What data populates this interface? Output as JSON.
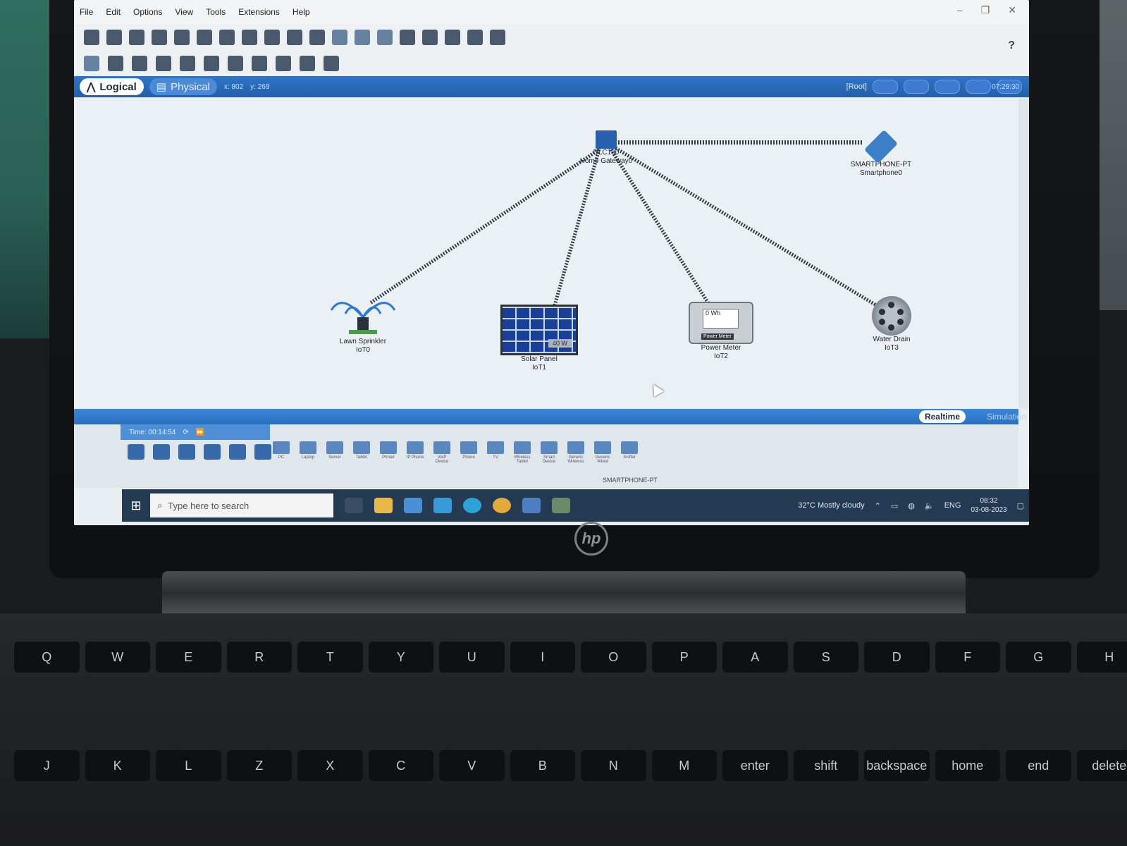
{
  "menu": [
    "File",
    "Edit",
    "Options",
    "View",
    "Tools",
    "Extensions",
    "Help"
  ],
  "help_mark": "?",
  "tabs": {
    "logical": "Logical",
    "physical": "Physical"
  },
  "coords": {
    "x": "x: 802",
    "y": "y: 269"
  },
  "root_label": "[Root]",
  "top_clock": "07:29:30",
  "devices": {
    "gateway": {
      "model": "DLC100",
      "name": "Home Gateway0"
    },
    "smartphone": {
      "model": "SMARTPHONE-PT",
      "name": "Smartphone0"
    },
    "sprinkler": {
      "model": "Lawn Sprinkler",
      "name": "IoT0"
    },
    "solar": {
      "model": "Solar Panel",
      "name": "IoT1",
      "reading": "40 W"
    },
    "meter": {
      "model": "Power Meter",
      "name": "IoT2",
      "reading": "0 Wh",
      "tag": "Power Meter"
    },
    "drain": {
      "model": "Water Drain",
      "name": "IoT3"
    }
  },
  "modes": {
    "realtime": "Realtime",
    "simulation": "Simulation"
  },
  "timebar": {
    "time": "Time: 00:14:54"
  },
  "palette_devices": [
    "PC",
    "Laptop",
    "Server",
    "Tablet",
    "Printer",
    "IP Phone",
    "VoIP Device",
    "Phone",
    "TV",
    "Wireless Tablet",
    "Smart Device",
    "Generic Wireless",
    "Generic Wired",
    "Sniffer"
  ],
  "selected_device": "SMARTPHONE-PT",
  "taskbar": {
    "search_placeholder": "Type here to search",
    "weather": "32°C  Mostly cloudy",
    "lang": "ENG",
    "time": "08:32",
    "date": "03-08-2023"
  },
  "keyboard_row": [
    "Q",
    "W",
    "E",
    "R",
    "T",
    "Y",
    "U",
    "I",
    "O",
    "P",
    "A",
    "S",
    "D",
    "F",
    "G",
    "H"
  ],
  "keyboard_row2": [
    "J",
    "K",
    "L",
    "Z",
    "X",
    "C",
    "V",
    "B",
    "N",
    "M",
    "enter",
    "shift",
    "backspace",
    "home",
    "end",
    "delete"
  ],
  "hp": "hp"
}
